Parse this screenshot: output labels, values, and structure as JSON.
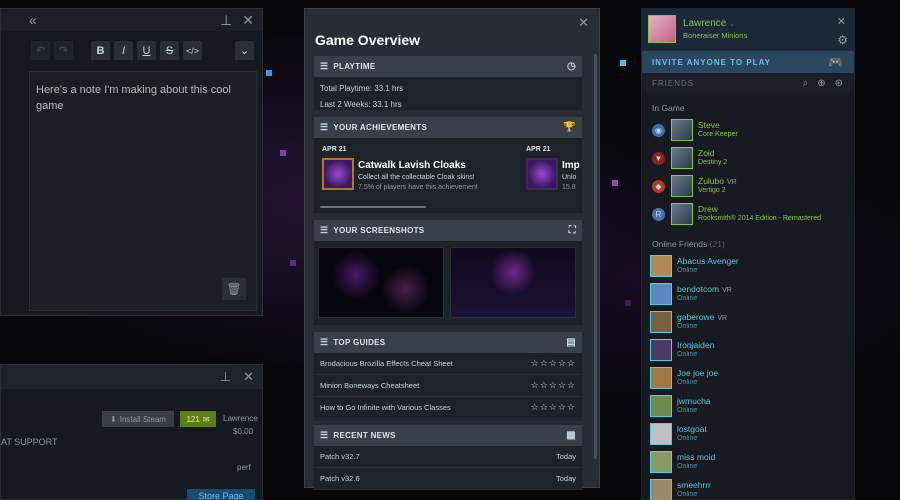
{
  "notes": {
    "text": "Here's a note I'm making about this cool game",
    "toolbar": [
      "B",
      "I",
      "U",
      "S",
      "</>"
    ]
  },
  "store": {
    "install_label": "Install Steam",
    "badge": "121",
    "user": "Lawrence",
    "price": "$0.00",
    "links": "AT   SUPPORT",
    "perf": "perf",
    "store_page_label": "Store Page"
  },
  "overview": {
    "title": "Game Overview",
    "playtime": {
      "header": "PLAYTIME",
      "total": "Total Playtime: 33.1 hrs",
      "recent": "Last 2 Weeks: 33.1 hrs"
    },
    "achievements": {
      "header": "YOUR ACHIEVEMENTS",
      "items": [
        {
          "date": "APR 21",
          "name": "Catwalk Lavish Cloaks",
          "desc": "Collect all the collectable Cloak skins!",
          "pct": "7.5% of players have this achievement"
        },
        {
          "date": "APR 21",
          "name": "Imp",
          "desc": "Unlo",
          "pct": "15.8"
        }
      ]
    },
    "screenshots": {
      "header": "YOUR SCREENSHOTS"
    },
    "guides": {
      "header": "TOP GUIDES",
      "items": [
        "Brodacious Brozilla Effects Cheat Sheet",
        "Minion Boneways Cheatsheet",
        "How to Go Infinite with Various Classes"
      ]
    },
    "news": {
      "header": "RECENT NEWS",
      "items": [
        {
          "title": "Patch v32.7",
          "date": "Today"
        },
        {
          "title": "Patch v32.6",
          "date": "Today"
        }
      ]
    }
  },
  "friends": {
    "user": {
      "name": "Lawrence",
      "game": "Boneraiser Minions"
    },
    "invite": "INVITE ANYONE TO PLAY",
    "title": "FRIENDS",
    "in_game_label": "In Game",
    "in_game": [
      {
        "name": "Steve",
        "tag": "",
        "game": "Core Keeper",
        "icon": "◉",
        "color": "#3a6ea5"
      },
      {
        "name": "Zoid",
        "tag": "",
        "game": "Destiny 2",
        "icon": "▼",
        "color": "#8b2020"
      },
      {
        "name": "Zulubo",
        "tag": "VR",
        "game": "Vertigo 2",
        "icon": "◆",
        "color": "#b33a2a"
      },
      {
        "name": "Drew",
        "tag": "",
        "game": "Rocksmith® 2014 Edition - Remastered",
        "icon": "R",
        "color": "#4a6fa5"
      }
    ],
    "online_label": "Online Friends",
    "online_count": "(21)",
    "online": [
      {
        "name": "Abacus Avenger",
        "tag": "",
        "status": "Online",
        "color": "#b08a50"
      },
      {
        "name": "bendotcom",
        "tag": "VR",
        "status": "Online",
        "color": "#5a8ac0"
      },
      {
        "name": "gaberowe",
        "tag": "VR",
        "status": "Online",
        "color": "#7a6040"
      },
      {
        "name": "Ironjaiden",
        "tag": "",
        "status": "Online",
        "color": "#4a3a6a"
      },
      {
        "name": "Joe joe joe",
        "tag": "",
        "status": "Online",
        "color": "#a07a40"
      },
      {
        "name": "jwmucha",
        "tag": "",
        "status": "Online",
        "color": "#6a8a50"
      },
      {
        "name": "lostgoat",
        "tag": "",
        "status": "Online",
        "color": "#c0c0c0"
      },
      {
        "name": "miss moid",
        "tag": "",
        "status": "Online",
        "color": "#8a9a60"
      },
      {
        "name": "smeehrrr",
        "tag": "",
        "status": "Online",
        "color": "#9a8a6a"
      }
    ]
  }
}
